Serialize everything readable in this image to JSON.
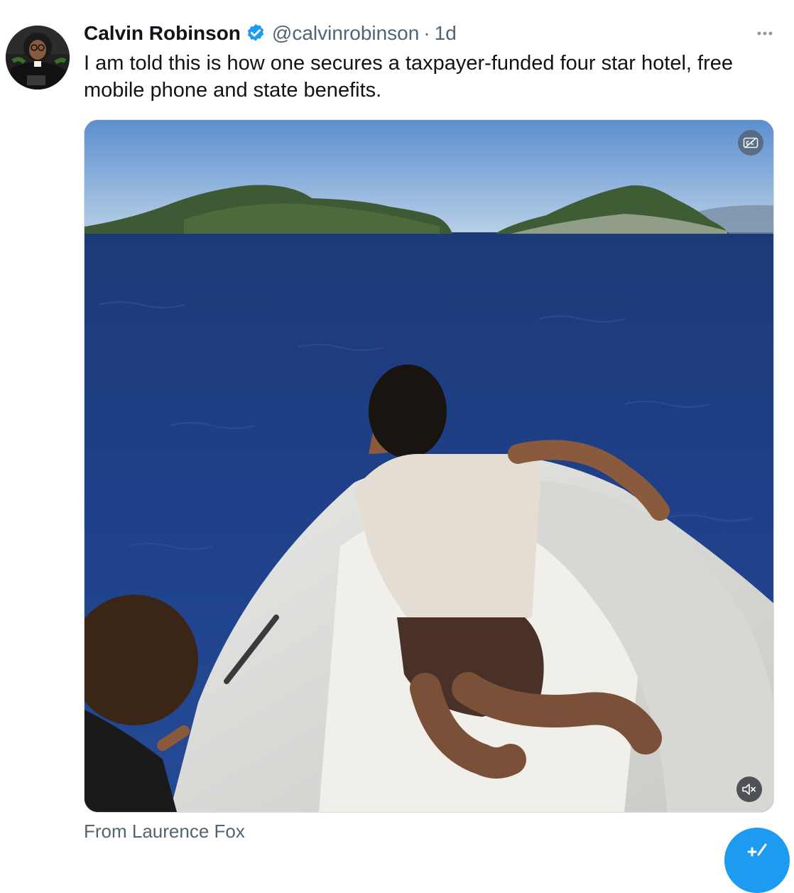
{
  "tweet": {
    "author_name": "Calvin Robinson",
    "handle": "@calvinrobinson",
    "separator": "·",
    "time": "1d",
    "text": "I am told this is how one secures a taxpayer-funded four star hotel, free mobile phone and state benefits.",
    "source_label": "From Laurence Fox"
  },
  "media": {
    "type": "video",
    "description_icon": "no-captions-icon",
    "audio_state": "muted"
  },
  "icons": {
    "verified": "verified-badge-icon",
    "more": "more-icon",
    "compose": "compose-icon"
  },
  "colors": {
    "text": "#0f1419",
    "secondary_text": "#536471",
    "verified": "#1d9bf0",
    "fab": "#1d9bf0"
  }
}
